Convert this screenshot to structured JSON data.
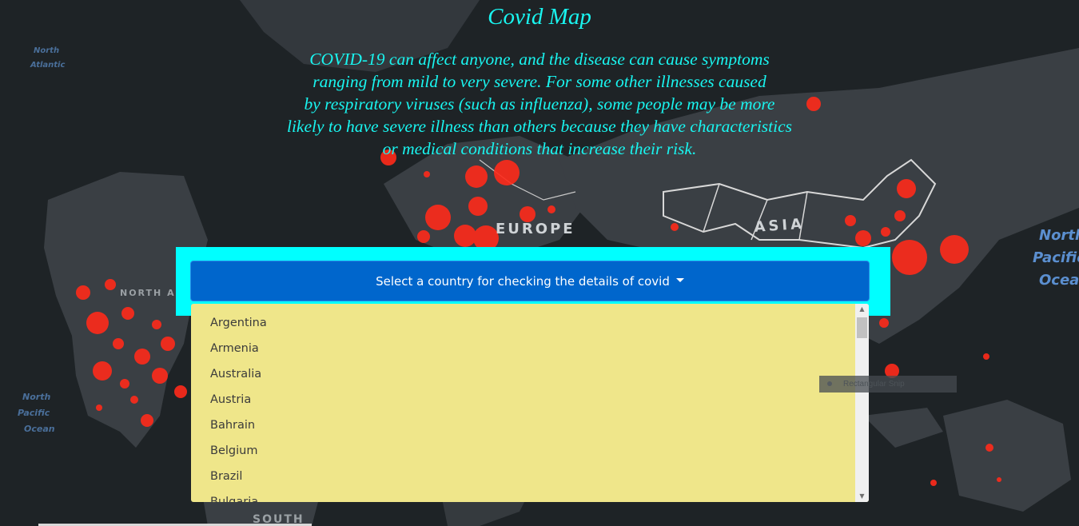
{
  "page": {
    "title": "Covid Map",
    "intro_lines": [
      "COVID-19 can affect anyone, and the disease can cause symptoms",
      "ranging from mild to very severe. For some other illnesses caused",
      "by respiratory viruses (such as influenza), some people may be more",
      "likely to have severe illness than others because they have characteristics",
      "or medical conditions that increase their risk."
    ]
  },
  "map": {
    "labels": {
      "europe": "EUROPE",
      "asia": "ASIA",
      "north_america": "NORTH AMERICA",
      "south": "SOUTH",
      "north_pacific": [
        "North",
        "Pacific",
        "Ocean"
      ],
      "north_pacific_left": [
        "North",
        "Pacific",
        "Ocean"
      ],
      "north_atlantic": [
        "North",
        "Atlantic"
      ]
    },
    "colors": {
      "land": "#3a3f44",
      "ocean": "#1e2326",
      "border": "#d8d8d8",
      "hotspot": "#ff2a1a"
    }
  },
  "dropdown": {
    "button_label": "Select a country for checking the details of covid",
    "options": [
      "Argentina",
      "Armenia",
      "Australia",
      "Austria",
      "Bahrain",
      "Belgium",
      "Brazil",
      "Bulgaria"
    ],
    "panel_color": "#00ffff",
    "button_color": "#0066cc",
    "menu_color": "#efe68a"
  },
  "overlay": {
    "snip_label": "Rectangular Snip"
  }
}
